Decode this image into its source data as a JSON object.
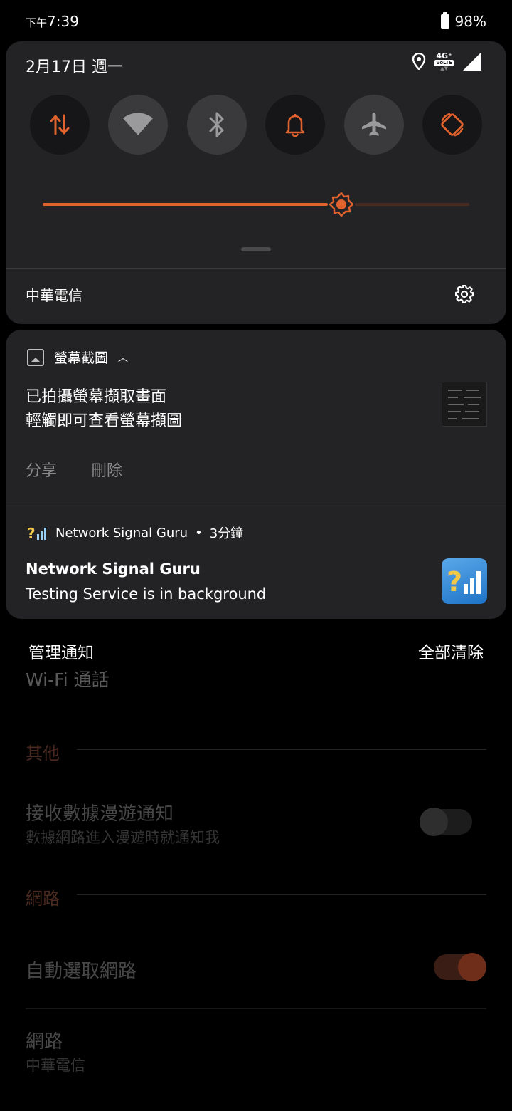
{
  "status_bar": {
    "ampm": "下午",
    "time": "7:39",
    "battery": "98%"
  },
  "quick_settings": {
    "date": "2月17日 週一",
    "network_badge": {
      "top": "4G⁺",
      "volte": "VoLTE"
    },
    "tiles": [
      {
        "name": "mobile-data",
        "icon": "data-arrows-icon",
        "state": "on"
      },
      {
        "name": "wifi",
        "icon": "wifi-icon",
        "state": "off"
      },
      {
        "name": "bluetooth",
        "icon": "bluetooth-icon",
        "state": "off"
      },
      {
        "name": "sound",
        "icon": "bell-icon",
        "state": "on"
      },
      {
        "name": "airplane-mode",
        "icon": "airplane-icon",
        "state": "off"
      },
      {
        "name": "auto-rotate",
        "icon": "rotate-icon",
        "state": "on"
      }
    ],
    "brightness_level": 0.7,
    "carrier": "中華電信"
  },
  "colors": {
    "accent": "#e0622d",
    "panel": "#232325",
    "tile_off": "#3a3a3c"
  },
  "notifications": {
    "screenshot": {
      "app_label": "螢幕截圖",
      "title": "已拍攝螢幕擷取畫面",
      "text": "輕觸即可查看螢幕擷圖",
      "actions": {
        "share": "分享",
        "delete": "刪除"
      }
    },
    "signal_guru": {
      "app_name": "Network Signal Guru",
      "separator": "•",
      "time": "3分鐘",
      "title": "Network Signal Guru",
      "text": "Testing Service is in background"
    },
    "manage_label": "管理通知",
    "clear_all_label": "全部清除"
  },
  "background_settings": {
    "wifi_calling": "Wi-Fi 通話",
    "section_other": "其他",
    "roaming_title": "接收數據漫遊通知",
    "roaming_sub": "數據網路進入漫遊時就通知我",
    "roaming_enabled": false,
    "section_network": "網路",
    "auto_select_title": "自動選取網路",
    "auto_select_enabled": true,
    "network_title": "網路",
    "network_value": "中華電信"
  }
}
